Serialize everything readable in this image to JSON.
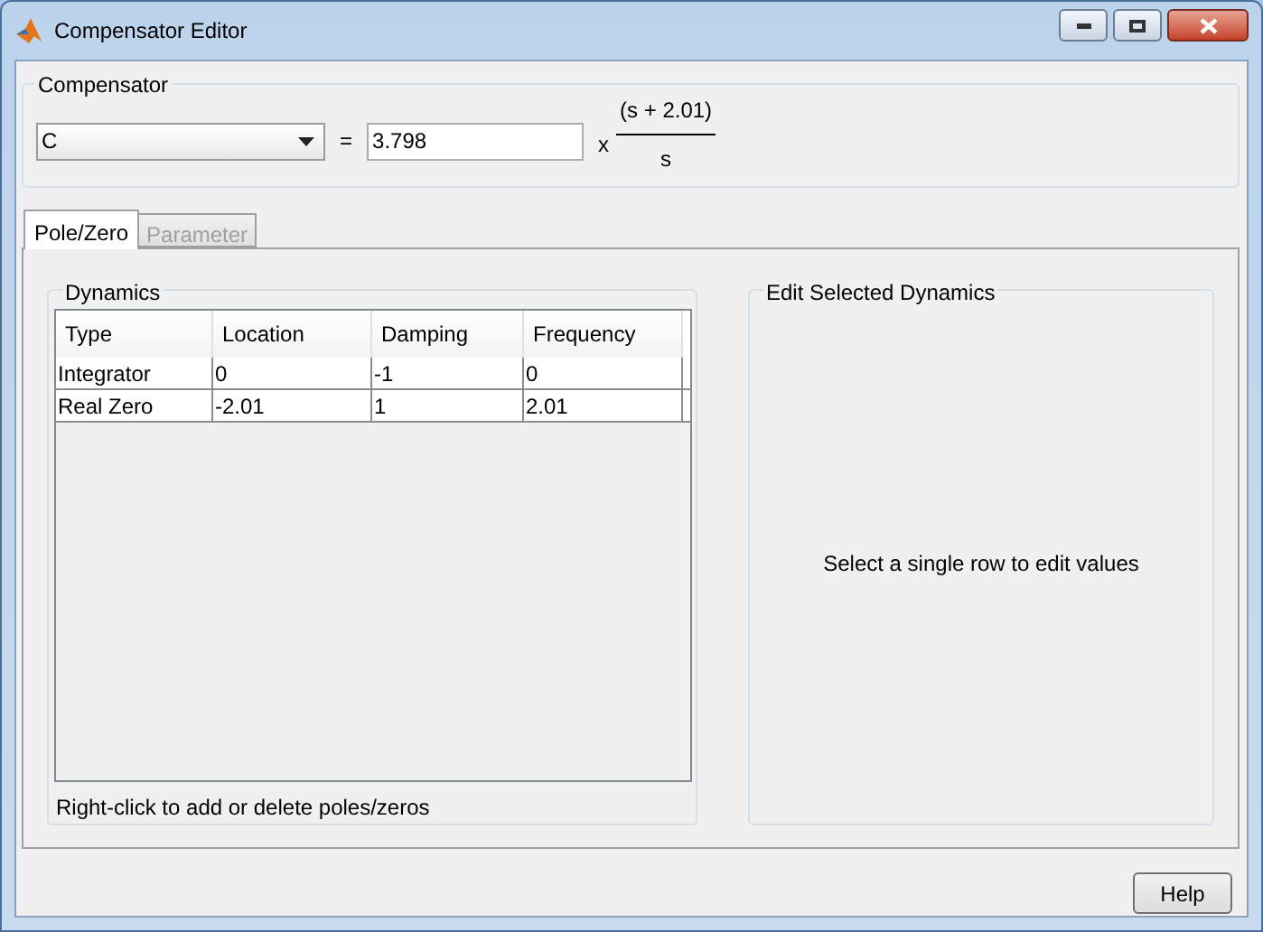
{
  "window": {
    "title": "Compensator Editor"
  },
  "compensator": {
    "label": "Compensator",
    "selector": "C",
    "gain": "3.798",
    "times": "x",
    "numerator": "(s + 2.01)",
    "denominator": "s",
    "equals": "="
  },
  "tabs": [
    {
      "label": "Pole/Zero",
      "selected": true,
      "disabled": false
    },
    {
      "label": "Parameter",
      "selected": false,
      "disabled": true
    }
  ],
  "dynamics": {
    "label": "Dynamics",
    "columns": [
      "Type",
      "Location",
      "Damping",
      "Frequency"
    ],
    "rows": [
      [
        "Integrator",
        "0",
        "-1",
        "0"
      ],
      [
        "Real Zero",
        "-2.01",
        "1",
        "2.01"
      ]
    ],
    "hint": "Right-click to add or delete poles/zeros"
  },
  "edit_panel": {
    "label": "Edit Selected Dynamics",
    "message": "Select a single row to edit values"
  },
  "buttons": [
    "Help"
  ]
}
